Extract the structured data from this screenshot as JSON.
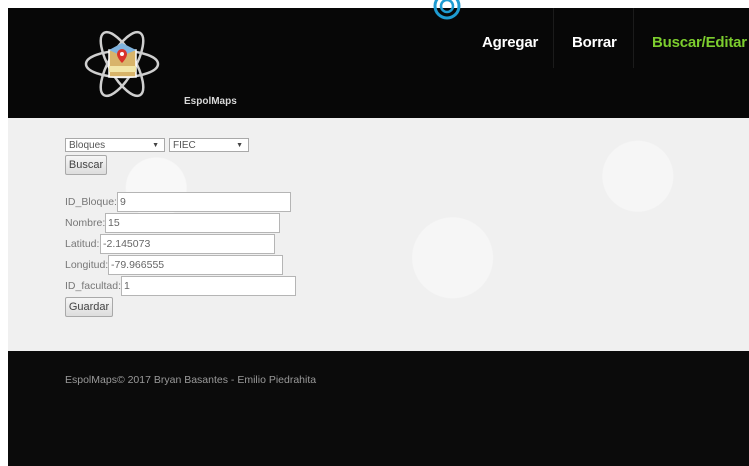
{
  "header": {
    "brand": "EspolMaps",
    "nav": {
      "agregar": "Agregar",
      "borrar": "Borrar",
      "buscar_editar": "Buscar/Editar"
    },
    "active_color": "#7ccd2e"
  },
  "search": {
    "type_select": "Bloques",
    "faculty_select": "FIEC",
    "button": "Buscar"
  },
  "form": {
    "id_bloque": {
      "label": "ID_Bloque:",
      "value": "9"
    },
    "nombre": {
      "label": "Nombre:",
      "value": "15"
    },
    "latitud": {
      "label": "Latitud:",
      "value": "-2.145073"
    },
    "longitud": {
      "label": "Longitud:",
      "value": "-79.966555"
    },
    "id_facultad": {
      "label": "ID_facultad:",
      "value": "1"
    },
    "save_button": "Guardar"
  },
  "footer": {
    "copyright": "EspolMaps© 2017 Bryan Basantes - Emilio Piedrahita"
  }
}
